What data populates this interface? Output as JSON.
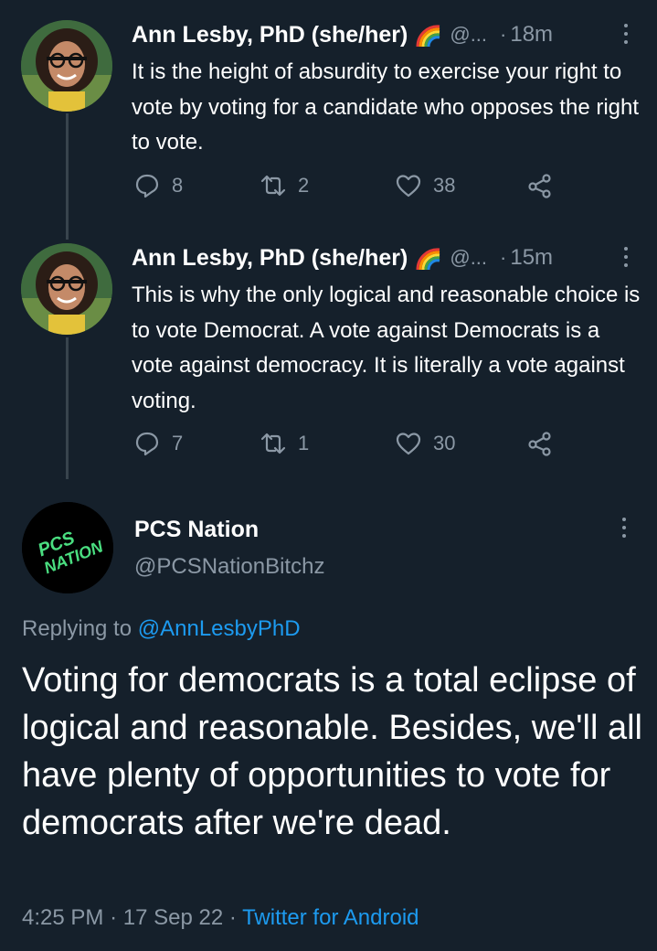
{
  "thread": [
    {
      "author_name": "Ann Lesby, PhD (she/her)",
      "author_emoji": "rainbow",
      "handle_truncated": "@...",
      "separator": "·",
      "time": "18m",
      "text": "It is the height of absurdity to exercise your right to vote by voting for a candidate who opposes the right to vote.",
      "replies": "8",
      "retweets": "2",
      "likes": "38"
    },
    {
      "author_name": "Ann Lesby, PhD (she/her)",
      "author_emoji": "rainbow",
      "handle_truncated": "@...",
      "separator": "·",
      "time": "15m",
      "text": "This is why the only logical and reasonable choice is to vote Democrat. A vote against Democrats is a vote against democracy. It is literally a vote against voting.",
      "replies": "7",
      "retweets": "1",
      "likes": "30"
    }
  ],
  "main_tweet": {
    "author_name": "PCS Nation",
    "handle": "@PCSNationBitchz",
    "avatar_text_line1": "PCS",
    "avatar_text_line2": "NATION",
    "replying_label": "Replying to",
    "replying_to": "@AnnLesbyPhD",
    "text": "Voting for democrats is a total eclipse of logical and reasonable. Besides, we'll all have plenty of opportunities to vote for democrats after we're dead.",
    "time": "4:25 PM",
    "sep1": "·",
    "date": "17 Sep 22",
    "sep2": "·",
    "source": "Twitter for Android"
  },
  "colors": {
    "background": "#15202b",
    "secondary_text": "#8b98a5",
    "link": "#1d9bf0",
    "avatar_green_text": "#4ade80"
  }
}
